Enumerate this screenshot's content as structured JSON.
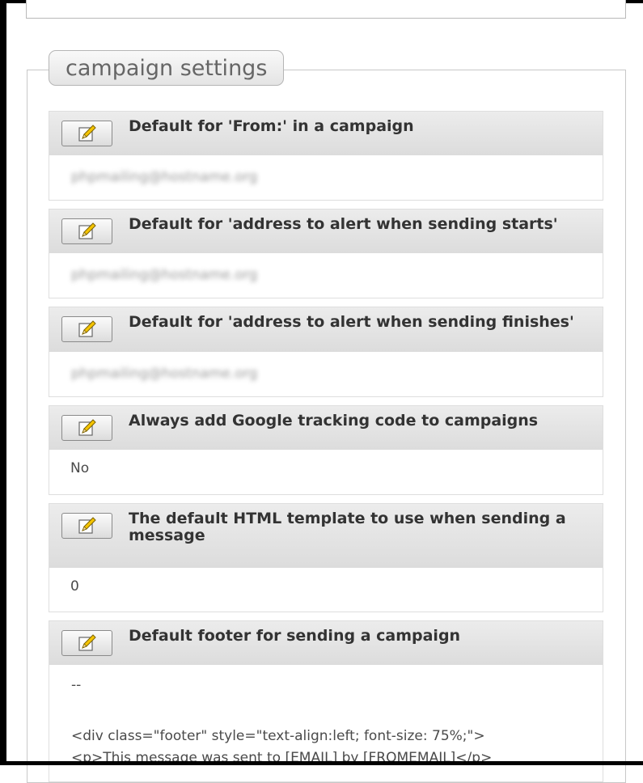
{
  "section": {
    "legend": "campaign settings"
  },
  "settings": [
    {
      "title": "Default for 'From:' in a campaign",
      "value": "phpmailing@hostname.org",
      "value_blurred": true
    },
    {
      "title": "Default for 'address to alert when sending starts'",
      "value": "phpmailing@hostname.org",
      "value_blurred": true
    },
    {
      "title": "Default for 'address to alert when sending finishes'",
      "value": "phpmailing@hostname.org",
      "value_blurred": true
    },
    {
      "title": "Always add Google tracking code to campaigns",
      "value": "No"
    },
    {
      "title": "The default HTML template to use when sending a message",
      "value": "0"
    },
    {
      "title": "Default footer for sending a campaign",
      "value_lines": [
        "--",
        "",
        "<div class=\"footer\" style=\"text-align:left; font-size: 75%;\">",
        "<p>This message was sent to [EMAIL] by [FROMEMAIL]</p>"
      ]
    }
  ],
  "icons": {
    "edit": "pencil-note-icon"
  },
  "colors": {
    "header_bg": "#e2e2e2",
    "border": "#dedede",
    "legend_text": "#666666"
  }
}
